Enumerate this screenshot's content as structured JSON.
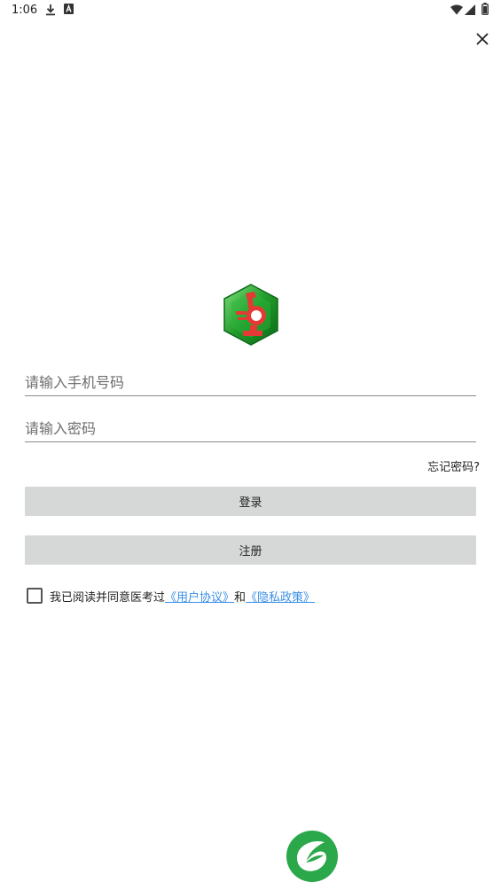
{
  "status_bar": {
    "time": "1:06"
  },
  "login_form": {
    "phone_placeholder": "请输入手机号码",
    "password_placeholder": "请输入密码",
    "forgot_password": "忘记密码?",
    "login_button": "登录",
    "register_button": "注册"
  },
  "agreement": {
    "prefix": "我已阅读并同意医考过",
    "user_agreement": "《用户协议》",
    "and": "和",
    "privacy_policy": "《隐私政策》",
    "checked": false
  },
  "colors": {
    "button_bg": "#d6d7d7",
    "link": "#3a8ee6",
    "brand_green": "#2aa84a",
    "logo_red": "#e53935"
  },
  "icons": {
    "download": "download-icon",
    "notification_a": "a-badge-icon",
    "wifi": "wifi-icon",
    "signal": "signal-icon",
    "battery": "battery-icon",
    "close": "close-icon",
    "app_logo": "microscope-logo-icon",
    "footer_logo": "leaf-logo-icon"
  }
}
